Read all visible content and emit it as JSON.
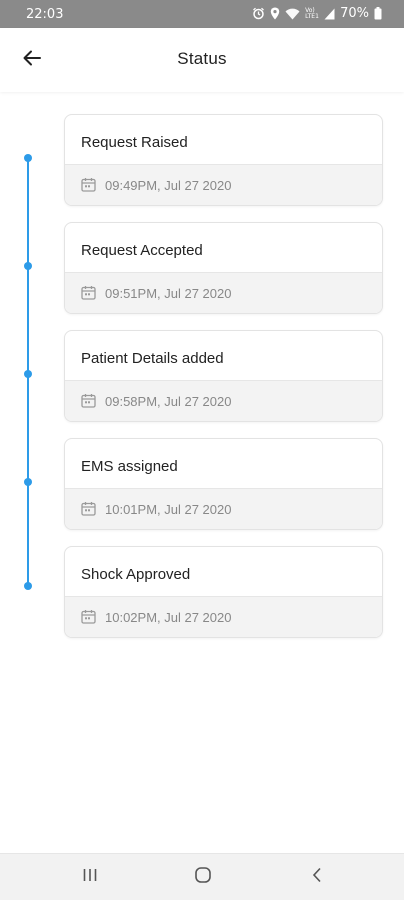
{
  "statusbar": {
    "time": "22:03",
    "signal_label": "Vo) LTE1",
    "battery": "70%"
  },
  "header": {
    "title": "Status"
  },
  "timeline": [
    {
      "title": "Request Raised",
      "time": "09:49PM, Jul 27 2020"
    },
    {
      "title": "Request Accepted",
      "time": "09:51PM, Jul 27 2020"
    },
    {
      "title": "Patient Details added",
      "time": "09:58PM, Jul 27 2020"
    },
    {
      "title": "EMS assigned",
      "time": "10:01PM, Jul 27 2020"
    },
    {
      "title": "Shock Approved",
      "time": "10:02PM, Jul 27 2020"
    }
  ],
  "icons": {
    "back": "arrow-left-icon",
    "date": "calendar-icon",
    "nav_recents": "recent-apps-icon",
    "nav_home": "home-icon",
    "nav_back": "chevron-left-icon"
  },
  "colors": {
    "accent": "#2d9be8",
    "statusbar": "#8a8a8a"
  }
}
